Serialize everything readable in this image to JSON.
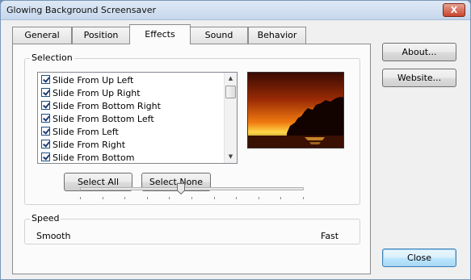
{
  "window": {
    "title": "Glowing Background Screensaver",
    "close_glyph": "X"
  },
  "tabs": [
    {
      "label": "General",
      "active": false
    },
    {
      "label": "Position",
      "active": false
    },
    {
      "label": "Effects",
      "active": true
    },
    {
      "label": "Sound",
      "active": false
    },
    {
      "label": "Behavior",
      "active": false
    }
  ],
  "selection": {
    "label": "Selection",
    "items": [
      {
        "label": "Slide From Up Left",
        "checked": true
      },
      {
        "label": "Slide From Up Right",
        "checked": true
      },
      {
        "label": "Slide From Bottom Right",
        "checked": true
      },
      {
        "label": "Slide From Bottom Left",
        "checked": true
      },
      {
        "label": "Slide From Left",
        "checked": true
      },
      {
        "label": "Slide From Right",
        "checked": true
      },
      {
        "label": "Slide From Bottom",
        "checked": true
      }
    ],
    "select_all_label": "Select All",
    "select_none_label": "Select None"
  },
  "speed": {
    "label": "Speed",
    "min_label": "Smooth",
    "max_label": "Fast",
    "value_fraction": 0.45
  },
  "side_buttons": {
    "about_label": "About...",
    "website_label": "Website...",
    "close_label": "Close"
  },
  "icons": {
    "scroll_up": "scroll-up-icon",
    "scroll_down": "scroll-down-icon",
    "checkbox": "checkmark-icon"
  }
}
